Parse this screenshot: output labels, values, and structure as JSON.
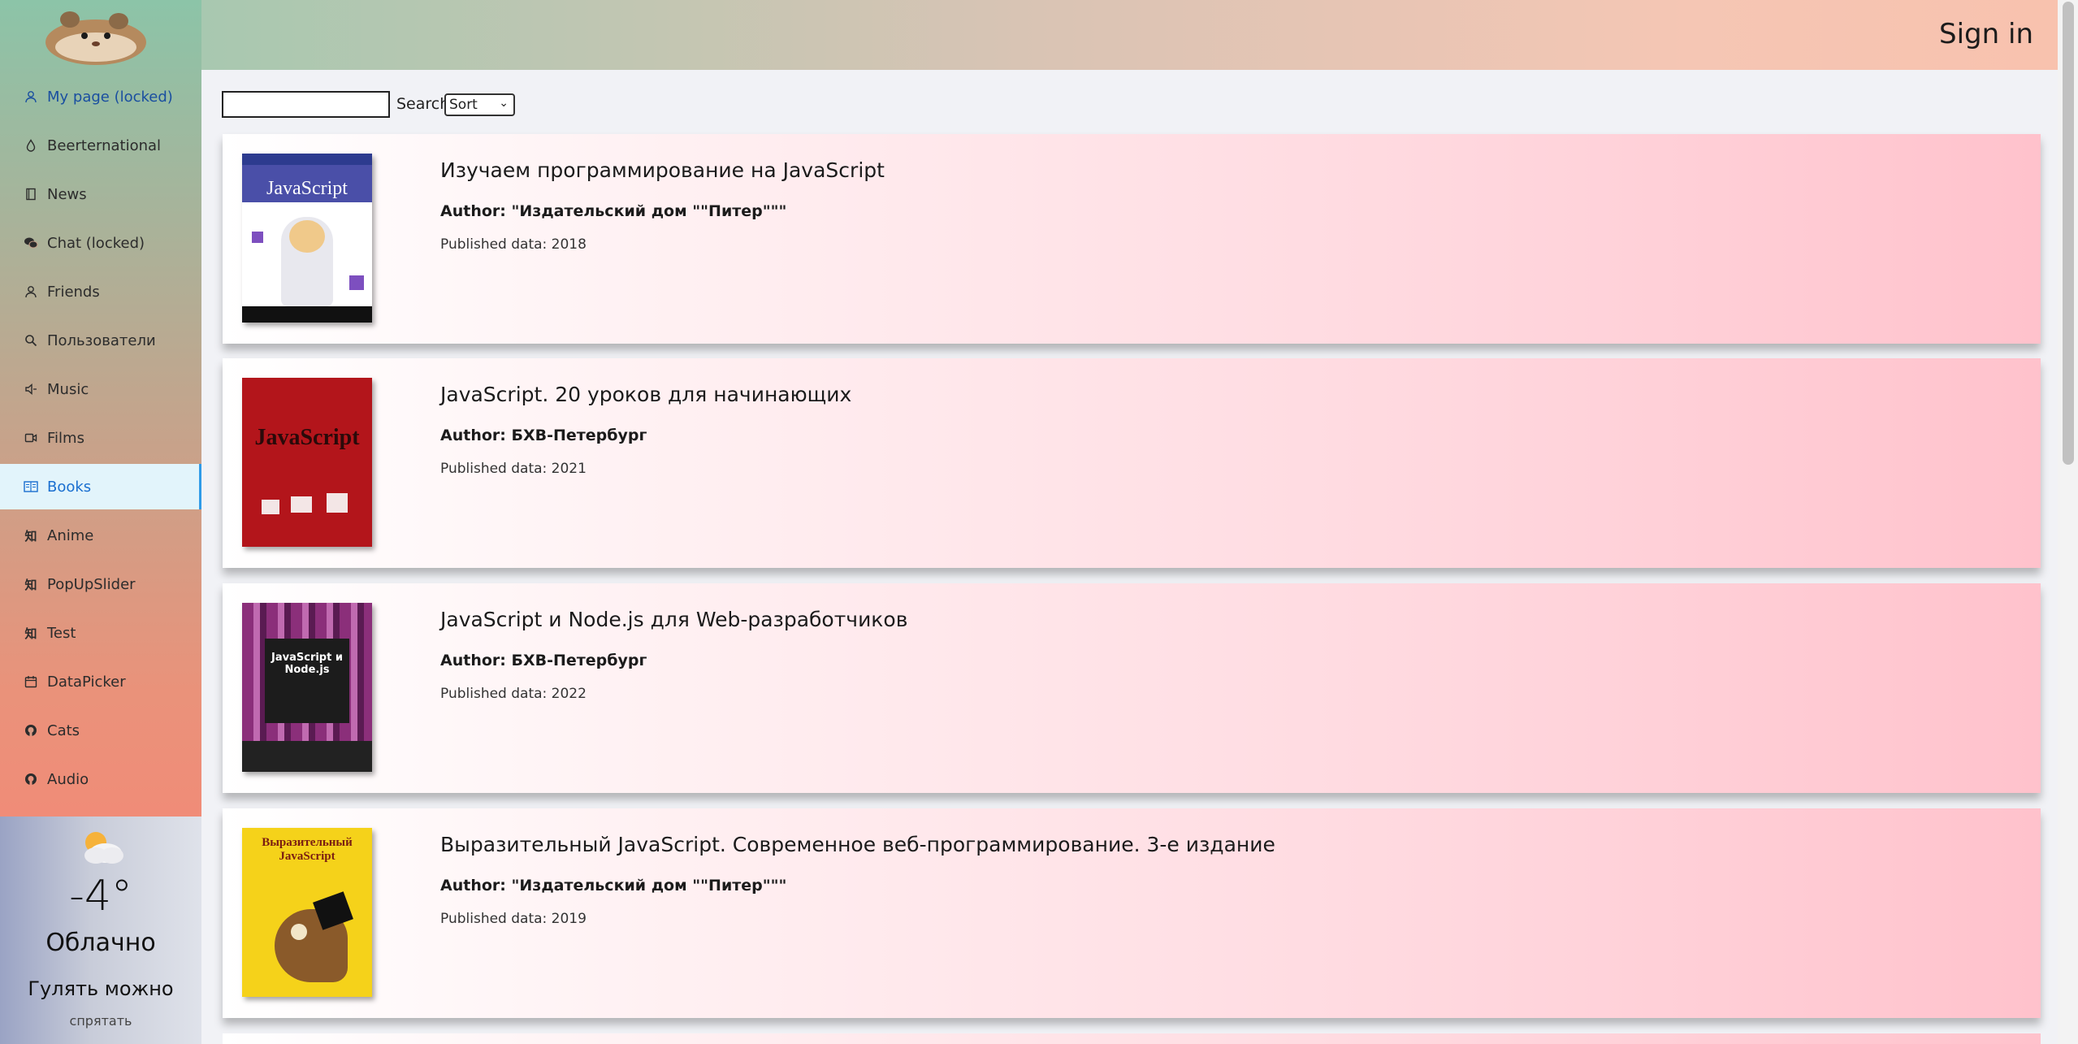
{
  "header": {
    "signin_label": "Sign in"
  },
  "sidebar": {
    "items": [
      {
        "label": "My page (locked)",
        "icon": "user-icon"
      },
      {
        "label": "Beerternational",
        "icon": "drop-icon"
      },
      {
        "label": "News",
        "icon": "book-icon"
      },
      {
        "label": "Chat (locked)",
        "icon": "chat-icon"
      },
      {
        "label": "Friends",
        "icon": "user-icon"
      },
      {
        "label": "Пользователи",
        "icon": "search-icon"
      },
      {
        "label": "Music",
        "icon": "speaker-icon"
      },
      {
        "label": "Films",
        "icon": "video-icon"
      },
      {
        "label": "Books",
        "icon": "reader-icon"
      },
      {
        "label": "Anime",
        "icon": "kanji-icon"
      },
      {
        "label": "PopUpSlider",
        "icon": "kanji-icon"
      },
      {
        "label": "Test",
        "icon": "kanji-icon"
      },
      {
        "label": "DataPicker",
        "icon": "calendar-icon"
      },
      {
        "label": "Cats",
        "icon": "github-icon"
      },
      {
        "label": "Audio",
        "icon": "github-icon"
      }
    ]
  },
  "weather": {
    "temperature": "-4°",
    "description": "Облачно",
    "advice": "Гулять можно",
    "hide_label": "спрятать",
    "icon": "cloud-sun-icon"
  },
  "search": {
    "value": "",
    "button_label": "Search",
    "sort_value": "Sort"
  },
  "books": [
    {
      "title": "Изучаем программирование на JavaScript",
      "author": "Author: \"Издательский дом \"\"Питер\"\"\"",
      "published": "Published data: 2018",
      "cover_color": "#ffffff",
      "cover_title": "JavaScript"
    },
    {
      "title": "JavaScript. 20 уроков для начинающих",
      "author": "Author: БХВ-Петербург",
      "published": "Published data: 2021",
      "cover_color": "#b3151b",
      "cover_title": "JavaScript"
    },
    {
      "title": "JavaScript и Node.js для Web-разработчиков",
      "author": "Author: БХВ-Петербург",
      "published": "Published data: 2022",
      "cover_color": "#8b2f7a",
      "cover_title": "JavaScript и Node.js"
    },
    {
      "title": "Выразительный JavaScript. Современное веб-программирование. 3-е издание",
      "author": "Author: \"Издательский дом \"\"Питер\"\"\"",
      "published": "Published data: 2019",
      "cover_color": "#f5d21a",
      "cover_title": "Выразительный JavaScript"
    }
  ]
}
